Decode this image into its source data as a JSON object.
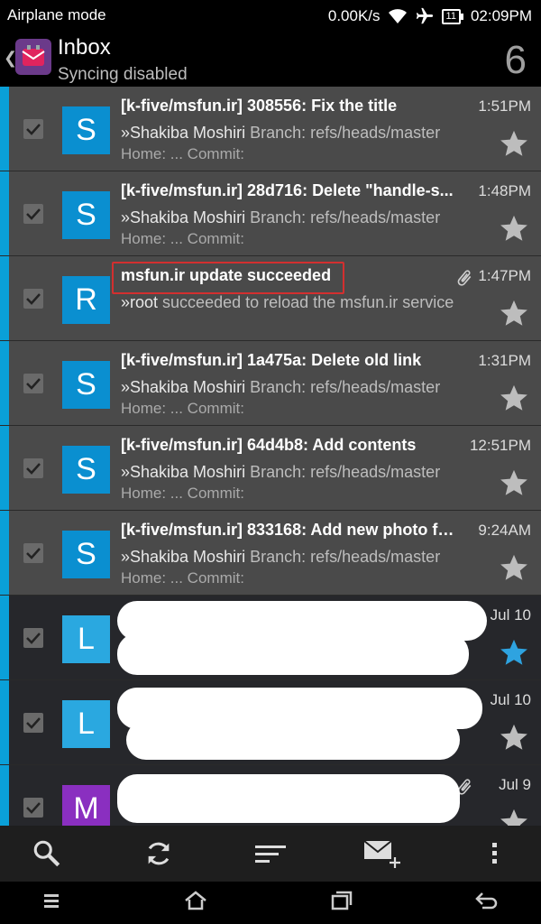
{
  "status": {
    "mode": "Airplane mode",
    "speed": "0.00K/s",
    "battery_level": "11",
    "time": "02:09PM"
  },
  "header": {
    "title": "Inbox",
    "subtitle": "Syncing disabled",
    "unread_count": "6"
  },
  "messages": [
    {
      "avatar": "S",
      "subject": "[k-five/msfun.ir] 308556: Fix the title",
      "time": "1:51PM",
      "sender": "»Shakiba Moshiri",
      "preview": "Branch: refs/heads/master",
      "preview2": "Home: ... Commit:"
    },
    {
      "avatar": "S",
      "subject": "[k-five/msfun.ir] 28d716: Delete \"handle-s...",
      "time": "1:48PM",
      "sender": "»Shakiba Moshiri",
      "preview": "Branch: refs/heads/master",
      "preview2": "Home: ... Commit:"
    },
    {
      "avatar": "R",
      "subject": "msfun.ir update succeeded",
      "time": "1:47PM",
      "sender": "»root",
      "preview": "succeeded to reload the msfun.ir service",
      "preview2": ""
    },
    {
      "avatar": "S",
      "subject": "[k-five/msfun.ir] 1a475a: Delete old link",
      "time": "1:31PM",
      "sender": "»Shakiba Moshiri",
      "preview": "Branch: refs/heads/master",
      "preview2": "Home: ... Commit:"
    },
    {
      "avatar": "S",
      "subject": "[k-five/msfun.ir] 64d4b8: Add contents",
      "time": "12:51PM",
      "sender": "»Shakiba Moshiri",
      "preview": "Branch: refs/heads/master",
      "preview2": "Home: ... Commit:"
    },
    {
      "avatar": "S",
      "subject": "[k-five/msfun.ir] 833168: Add new photo fo...",
      "time": "9:24AM",
      "sender": "»Shakiba Moshiri",
      "preview": "Branch: refs/heads/master",
      "preview2": "Home: ... Commit:"
    },
    {
      "avatar": "L",
      "time": "Jul 10",
      "starred": true
    },
    {
      "avatar": "L",
      "time": "Jul 10",
      "starred": false
    },
    {
      "avatar": "M",
      "time": "Jul 9",
      "starred": false
    }
  ],
  "colors": {
    "accent": "#0aa0d8",
    "avatar_blue": "#0a8fd0",
    "avatar_light_blue": "#2aa8e0",
    "avatar_purple": "#8a2fc0",
    "highlight": "#d32f2f"
  },
  "icons": {
    "toolbar": [
      "search-icon",
      "refresh-icon",
      "sort-icon",
      "compose-icon",
      "overflow-menu-icon"
    ],
    "nav": [
      "recent-apps-menu-icon",
      "home-icon",
      "recents-icon",
      "back-icon"
    ]
  }
}
